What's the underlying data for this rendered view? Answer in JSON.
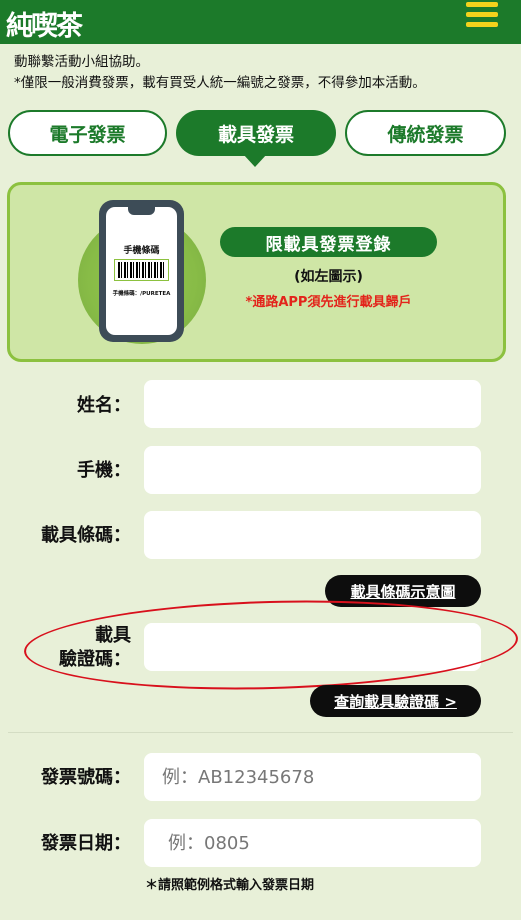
{
  "header": {
    "logo": "純喫茶"
  },
  "notice": {
    "line1": "動聯繫活動小組協助。",
    "line2": "*僅限一般消費發票，載有買受人統一編號之發票，不得參加本活動。"
  },
  "tabs": [
    {
      "label": "電子發票",
      "active": false
    },
    {
      "label": "載具發票",
      "active": true
    },
    {
      "label": "傳統發票",
      "active": false
    }
  ],
  "card": {
    "phone_title": "手機條碼",
    "phone_caption": "手機條碼：/PURETEA",
    "badge": "限載具發票登錄",
    "sub": "(如左圖示)",
    "warning": "*通路APP須先進行載具歸戶"
  },
  "form": {
    "name_label": "姓名：",
    "name_value": "",
    "phone_label": "手機：",
    "phone_value": "",
    "carrier_label": "載具條碼：",
    "carrier_value": "",
    "carrier_example_button": "載具條碼示意圖",
    "verify_label_1": "載具",
    "verify_label_2": "驗證碼：",
    "verify_value": "",
    "verify_query_button": "查詢載具驗證碼 >",
    "invoice_no_label": "發票號碼：",
    "invoice_no_placeholder": "例：AB12345678",
    "invoice_date_label": "發票日期：",
    "invoice_date_placeholder": "例：0805",
    "date_hint": "＊請照範例格式輸入發票日期"
  },
  "colors": {
    "brand_green": "#1c7a2a",
    "accent_yellow": "#f3d21c",
    "annotation_red": "#d8101c"
  }
}
